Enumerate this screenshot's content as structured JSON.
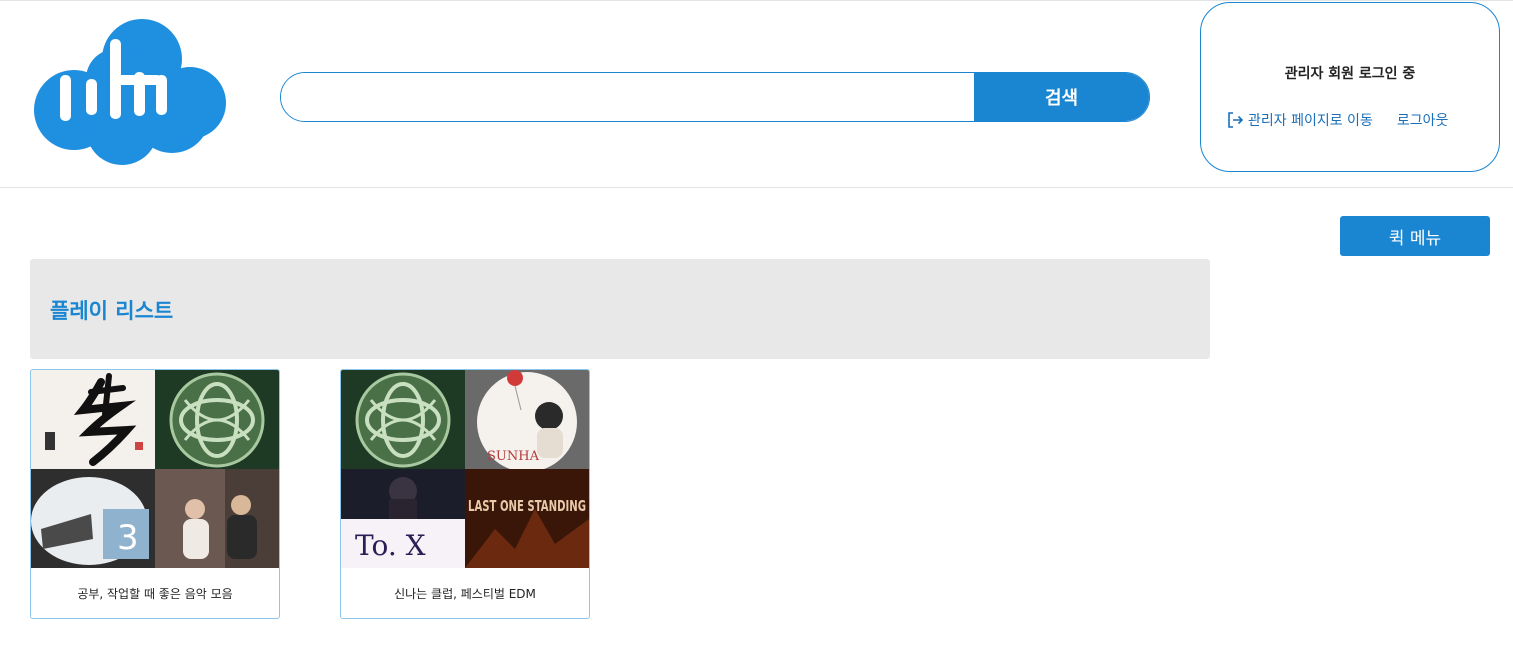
{
  "header": {
    "search": {
      "value": "",
      "button_label": "검색"
    },
    "login": {
      "status": "관리자 회원 로그인 중",
      "admin_link": "관리자 페이지로 이동",
      "logout_link": "로그아웃"
    }
  },
  "quick_menu_label": "퀵 메뉴",
  "section": {
    "title": "플레이 리스트"
  },
  "playlists": [
    {
      "title": "공부, 작업할 때 좋은 음악 모음",
      "thumb_text": [
        "",
        "",
        "",
        ""
      ]
    },
    {
      "title": "신나는 클럽, 페스티벌 EDM",
      "thumb_text": [
        "",
        "SUNHA",
        "To. X",
        "LAST ONE STANDING"
      ]
    }
  ],
  "colors": {
    "accent": "#1a86d2",
    "section_bg": "#e8e8e8",
    "card_border": "#8cc6ea"
  }
}
